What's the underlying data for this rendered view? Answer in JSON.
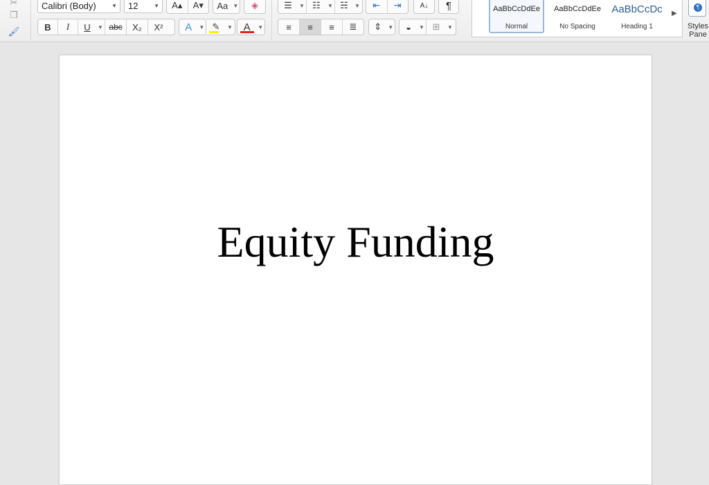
{
  "toolbar": {
    "font_name": "Calibri (Body)",
    "font_size": "12",
    "bold": "B",
    "italic": "I",
    "underline": "U",
    "strikethrough": "abc",
    "subscript": "X₂",
    "superscript": "X²",
    "grow_font": "A▴",
    "shrink_font": "A▾",
    "change_case": "Aa",
    "font_color_glyph": "A",
    "text_effects_glyph": "A",
    "highlight_color": "#ffee00",
    "font_color": "#e02020",
    "pilcrow": "¶",
    "sort_glyph": "A↓"
  },
  "styles": {
    "items": [
      {
        "sample": "AaBbCcDdEe",
        "name": "Normal"
      },
      {
        "sample": "AaBbCcDdEe",
        "name": "No Spacing"
      },
      {
        "sample": "AaBbCcDc",
        "name": "Heading 1",
        "color": "#2e5e8f"
      }
    ],
    "pane_label": "Styles Pane"
  },
  "document": {
    "title": "Equity Funding"
  }
}
